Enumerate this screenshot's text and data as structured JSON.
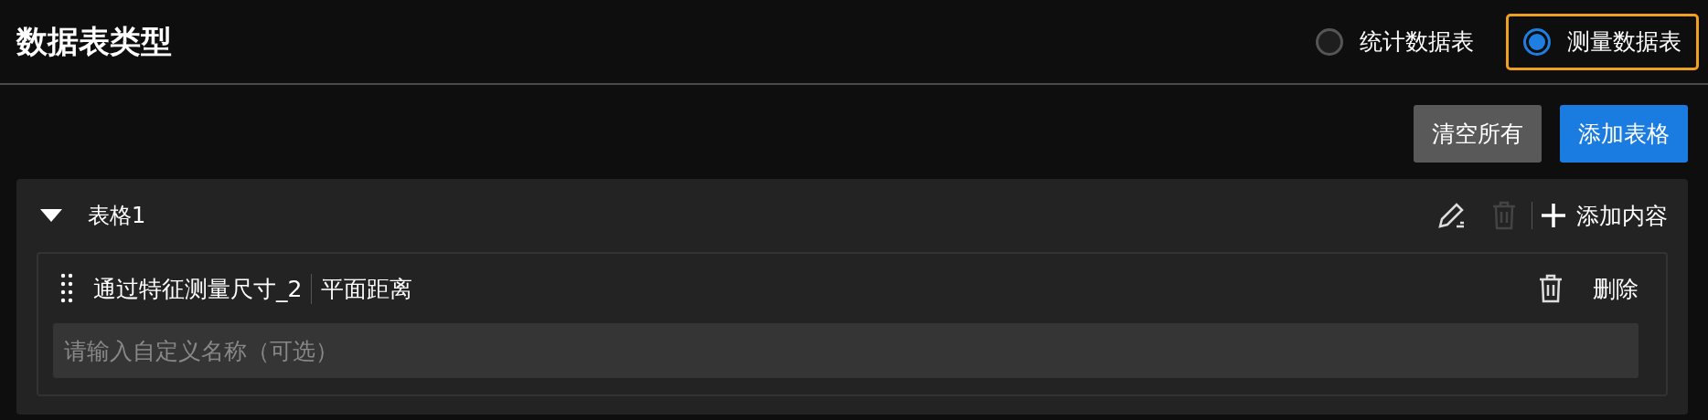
{
  "title": "数据表类型",
  "table_types": [
    {
      "label": "统计数据表",
      "selected": false,
      "focused": false
    },
    {
      "label": "测量数据表",
      "selected": true,
      "focused": true
    }
  ],
  "buttons": [
    {
      "label": "清空所有",
      "kind": "secondary"
    },
    {
      "label": "添加表格",
      "kind": "primary"
    }
  ],
  "tables": [
    {
      "name": "表格1",
      "expanded": true,
      "delete_disabled": true,
      "add_label": "添加内容",
      "items": [
        {
          "source": "通过特征测量尺寸_2",
          "measure": "平面距离",
          "delete_label": "删除",
          "placeholder": "请输入自定义名称（可选）"
        }
      ]
    }
  ]
}
